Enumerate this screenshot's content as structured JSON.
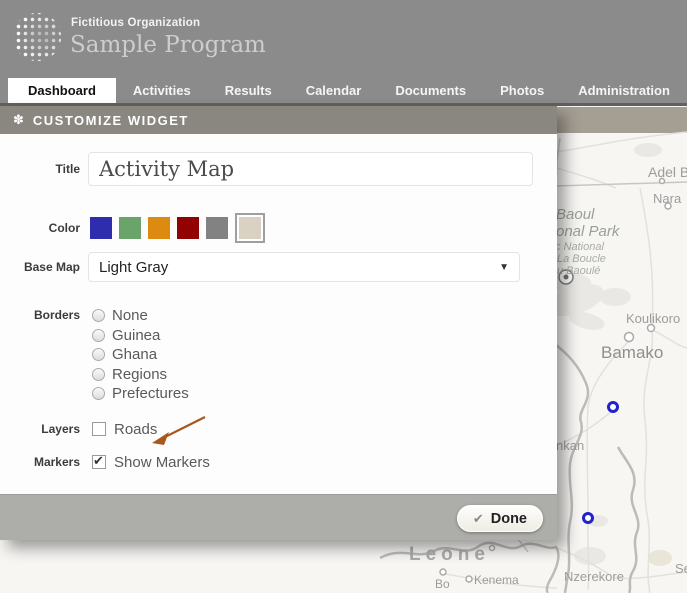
{
  "header": {
    "org": "Fictitious Organization",
    "program": "Sample Program"
  },
  "nav": {
    "items": [
      {
        "label": "Dashboard",
        "active": true
      },
      {
        "label": "Activities",
        "active": false
      },
      {
        "label": "Results",
        "active": false
      },
      {
        "label": "Calendar",
        "active": false
      },
      {
        "label": "Documents",
        "active": false
      },
      {
        "label": "Photos",
        "active": false
      },
      {
        "label": "Administration",
        "active": false
      }
    ]
  },
  "dialog": {
    "header": "CUSTOMIZE WIDGET",
    "fields": {
      "title_label": "Title",
      "title_value": "Activity Map",
      "color_label": "Color",
      "colors": [
        "#2d2dad",
        "#6aa46a",
        "#dc8a10",
        "#930202",
        "#828282",
        "#d9d1c2"
      ],
      "selected_color_index": 5,
      "basemap_label": "Base Map",
      "basemap_value": "Light Gray",
      "borders_label": "Borders",
      "borders_options": [
        "None",
        "Guinea",
        "Ghana",
        "Regions",
        "Prefectures"
      ],
      "layers_label": "Layers",
      "roads_label": "Roads",
      "roads_checked": false,
      "markers_label": "Markers",
      "show_markers_label": "Show Markers",
      "show_markers_checked": true
    },
    "done_label": "Done"
  },
  "icons": {
    "gear": "✽",
    "check": "✔",
    "dropdown_arrow": "▼"
  },
  "annotation_color": "#a8571e",
  "map": {
    "labels": {
      "adel_ba": "Adel Ba",
      "nara": "Nara",
      "baoul": "Baoul",
      "onal_park": "onal Park",
      "c_national": "c National",
      "la_boucle": "La Boucle",
      "u_baoule": "u Baoulé",
      "koulikoro": "Koulikoro",
      "bamako": "Bamako",
      "nkan": "nkan",
      "leone": "Leone",
      "bo": "Bo",
      "kenema": "Kenema",
      "nzerekore": "Nzerekore",
      "se": "Se"
    },
    "marker_color": "#2222cc"
  }
}
